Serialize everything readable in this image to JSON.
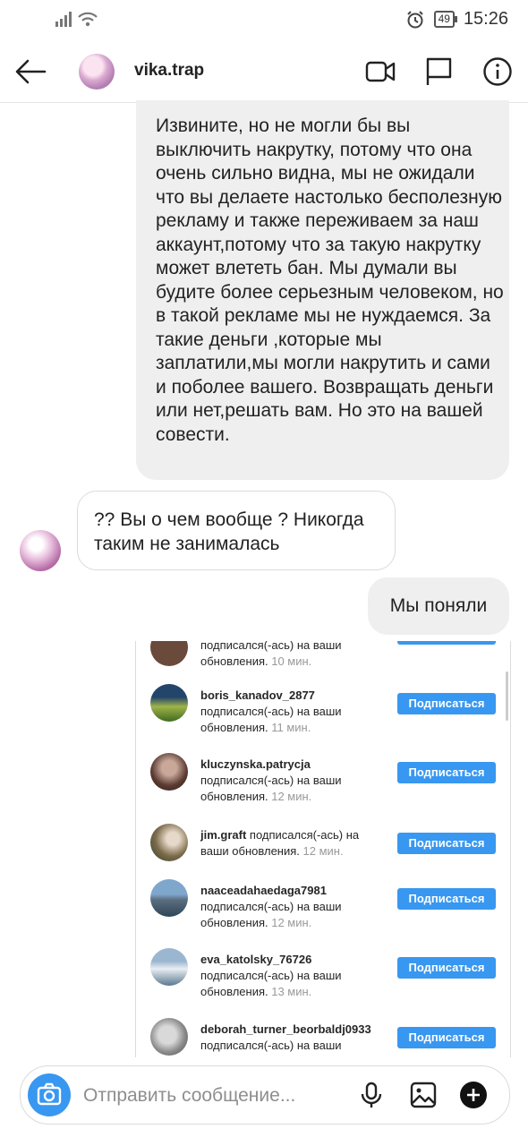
{
  "status_bar": {
    "time": "15:26",
    "battery": "49"
  },
  "header": {
    "username": "vika.trap"
  },
  "messages": [
    {
      "text": "Извините, но не могли бы вы выключить накрутку, потому что она очень сильно видна, мы не ожидали что вы делаете настолько бесполезную рекламу и также переживаем за наш аккаунт,потому что за такую накрутку может влететь бан. Мы думали вы будите более серьезным человеком, но в такой рекламе мы не нуждаемся. За такие деньги ,которые мы заплатили,мы могли накрутить и сами и поболее вашего. Возвращать деньги или нет,решать вам. Но это на вашей совести."
    },
    {
      "text": "?? Вы о чем вообще ? Никогда таким не занималась"
    },
    {
      "text": "Мы поняли"
    }
  ],
  "screenshot": {
    "partial_top": {
      "action": "подписался(-ась) на ваши",
      "tail": "обновления.",
      "time": "10 мин."
    },
    "followers": [
      {
        "username": "boris_kanadov_2877",
        "action": "подписался(-ась) на ваши обновления.",
        "time": "11 мин.",
        "button": "Подписаться"
      },
      {
        "username": "kluczynska.patrycja",
        "action": "подписался(-ась) на ваши обновления.",
        "time": "12 мин.",
        "button": "Подписаться"
      },
      {
        "username": "jim.graft",
        "action": "подписался(-ась) на ваши обновления.",
        "time": "12 мин.",
        "button": "Подписаться"
      },
      {
        "username": "naaceadahaedaga7981",
        "action": "подписался(-ась) на ваши обновления.",
        "time": "12 мин.",
        "button": "Подписаться"
      },
      {
        "username": "eva_katolsky_76726",
        "action": "подписался(-ась) на ваши обновления.",
        "time": "13 мин.",
        "button": "Подписаться"
      },
      {
        "username": "deborah_turner_beorbaldj0933",
        "action": "подписался(-ась) на ваши",
        "time": "",
        "button": "Подписаться"
      }
    ]
  },
  "composer": {
    "placeholder": "Отправить сообщение..."
  },
  "colors": {
    "accent": "#3897f0",
    "bubble_gray": "#efefef"
  }
}
